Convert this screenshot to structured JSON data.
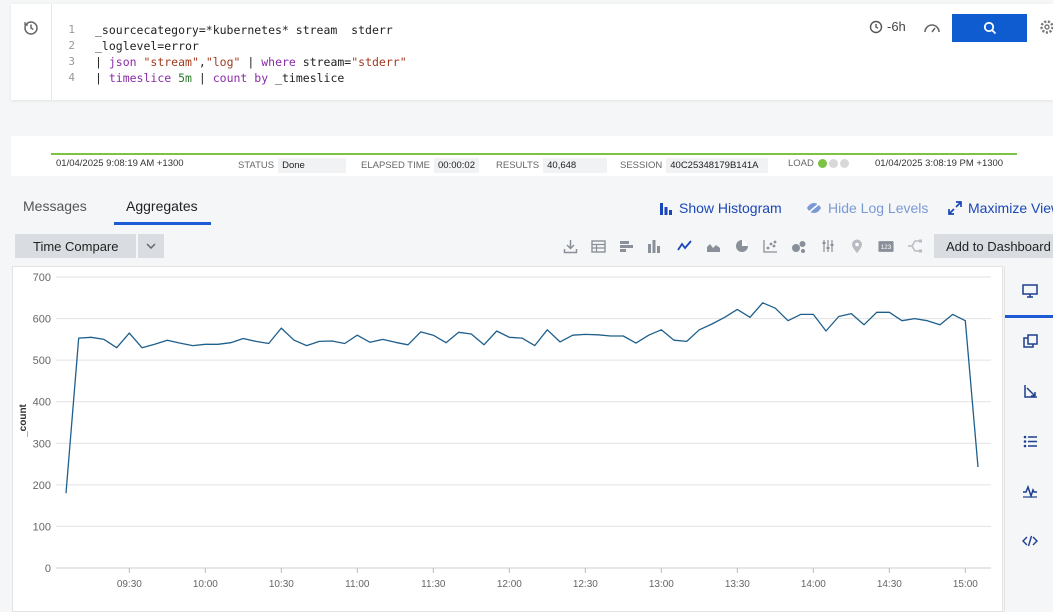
{
  "query": {
    "line_numbers": [
      "1",
      "2",
      "3",
      "4"
    ],
    "line1": "_sourcecategory=*kubernetes* stream  stderr",
    "line2": "_loglevel=error",
    "line3": {
      "pipe": "| ",
      "kw1": "json",
      "s1": " \"stream\"",
      "comma": ",",
      "s2": "\"log\"",
      "pipe2": " | ",
      "kw2": "where",
      "rest": " stream=",
      "s3": "\"stderr\""
    },
    "line4": {
      "pipe": "| ",
      "kw1": "timeslice",
      "num": " 5m",
      "pipe2": " | ",
      "kw2": "count",
      "sp": " ",
      "kw3": "by",
      "rest": " _timeslice"
    },
    "time_range": "-6h"
  },
  "status": {
    "start": "01/04/2025 9:08:19 AM +1300",
    "end": "01/04/2025 3:08:19 PM +1300",
    "status_label": "STATUS",
    "status_value": "Done",
    "elapsed_label": "ELAPSED TIME",
    "elapsed_value": "00:00:02",
    "results_label": "RESULTS",
    "results_value": "40,648",
    "session_label": "SESSION",
    "session_value": "40C25348179B141A",
    "load_label": "LOAD"
  },
  "tabs": {
    "messages": "Messages",
    "aggregates": "Aggregates"
  },
  "actions": {
    "show_histogram": "Show Histogram",
    "hide_log_levels": "Hide Log Levels",
    "maximize": "Maximize View"
  },
  "toolbar": {
    "time_compare": "Time Compare",
    "add_to_dashboard": "Add to Dashboard"
  },
  "colors": {
    "accent": "#1d5bd6",
    "series": "#1f5f8b",
    "progress": "#7cc243"
  },
  "chart_data": {
    "type": "line",
    "ylabel": "_count",
    "xlabel": "",
    "ylim": [
      0,
      700
    ],
    "yticks": [
      0,
      100,
      200,
      300,
      400,
      500,
      600,
      700
    ],
    "xticks": [
      "09:30",
      "10:00",
      "10:30",
      "11:00",
      "11:30",
      "12:00",
      "12:30",
      "13:00",
      "13:30",
      "14:00",
      "14:30",
      "15:00"
    ],
    "x_start": "09:05",
    "x_step_minutes": 5,
    "series": [
      {
        "values": [
          180,
          553,
          555,
          550,
          530,
          565,
          530,
          538,
          548,
          541,
          535,
          538,
          538,
          542,
          552,
          545,
          540,
          577,
          548,
          535,
          545,
          546,
          540,
          560,
          543,
          550,
          543,
          537,
          568,
          560,
          542,
          567,
          563,
          537,
          570,
          555,
          553,
          535,
          573,
          544,
          560,
          562,
          561,
          558,
          558,
          541,
          560,
          573,
          548,
          545,
          573,
          587,
          603,
          622,
          603,
          638,
          625,
          595,
          610,
          610,
          570,
          605,
          612,
          585,
          615,
          615,
          595,
          600,
          595,
          585,
          610,
          595,
          243
        ]
      }
    ]
  }
}
